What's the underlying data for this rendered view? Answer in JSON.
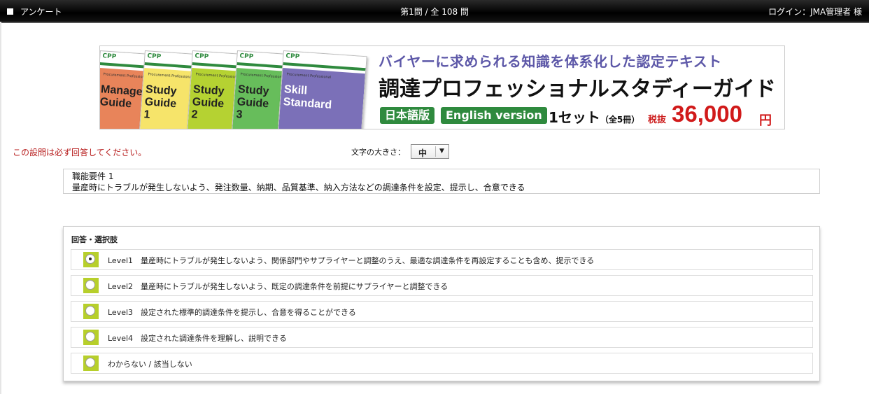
{
  "topbar": {
    "app_title": "アンケート",
    "progress": "第1問 / 全 108 問",
    "login": "ログイン：JMA管理者 様"
  },
  "banner": {
    "books": [
      {
        "lines": [
          "Manager",
          "Guide"
        ]
      },
      {
        "lines": [
          "Study",
          "Guide",
          "1"
        ]
      },
      {
        "lines": [
          "Study",
          "Guide",
          "2"
        ]
      },
      {
        "lines": [
          "Study",
          "Guide",
          "3"
        ]
      },
      {
        "lines": [
          "Skill",
          "Standard"
        ]
      }
    ],
    "book_colors": [
      "#e8845a",
      "#f6e46a",
      "#b5d232",
      "#67bd5b",
      "#7b70b8"
    ],
    "book_logo": "CPP",
    "book_subtitle": "Procurement Professional",
    "headline": "バイヤーに求められる知識を体系化した認定テキスト",
    "title": "調達プロフェッショナルスタディーガイド",
    "tag_japanese": "日本語版",
    "tag_english": "English version",
    "set_text": "1セット",
    "set_count": "（全5冊）",
    "tax_label": "税抜",
    "price": "36,000",
    "currency": "円"
  },
  "required_notice": "この設問は必ず回答してください。",
  "font_size": {
    "label": "文字の大きさ：",
    "selected": "中"
  },
  "question": {
    "title": "職能要件 1",
    "text": "量産時にトラブルが発生しないよう、発注数量、納期、品質基準、納入方法などの調達条件を設定、提示し、合意できる"
  },
  "answers": {
    "heading": "回答・選択肢",
    "options": [
      {
        "label": "Level1　量産時にトラブルが発生しないよう、関係部門やサプライヤーと調整のうえ、最適な調達条件を再設定することも含め、提示できる",
        "selected": true
      },
      {
        "label": "Level2　量産時にトラブルが発生しないよう、既定の調達条件を前提にサプライヤーと調整できる",
        "selected": false
      },
      {
        "label": "Level3　設定された標準的調達条件を提示し、合意を得ることができる",
        "selected": false
      },
      {
        "label": "Level4　設定された調達条件を理解し、説明できる",
        "selected": false
      },
      {
        "label": "わからない / 該当しない",
        "selected": false
      }
    ]
  },
  "colors": {
    "accent_green": "#2f8a3e",
    "radio_bg": "#b7cf2b",
    "notice_red": "#b71c1c",
    "price_red": "#d11a1a",
    "headline_purple": "#5d58a8"
  }
}
